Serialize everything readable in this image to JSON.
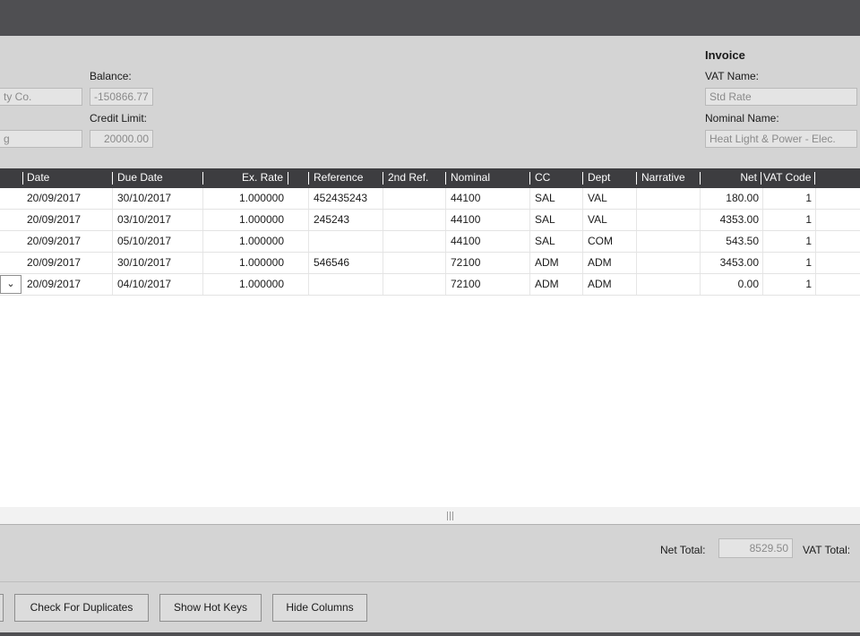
{
  "header": {
    "account_name_value": "ty Co.",
    "account_type_value": "g",
    "balance_label": "Balance:",
    "balance_value": "-150866.77",
    "credit_limit_label": "Credit Limit:",
    "credit_limit_value": "20000.00",
    "invoice_heading": "Invoice",
    "vat_name_label": "VAT Name:",
    "vat_name_value": "Std Rate",
    "nominal_name_label": "Nominal Name:",
    "nominal_name_value": "Heat Light & Power - Elec."
  },
  "grid": {
    "columns": [
      "Date",
      "Due Date",
      "Ex. Rate",
      "Reference",
      "2nd Ref.",
      "Nominal",
      "CC",
      "Dept",
      "Narrative",
      "Net",
      "VAT Code"
    ],
    "rows": [
      [
        "20/09/2017",
        "30/10/2017",
        "1.000000",
        "452435243",
        "",
        "44100",
        "SAL",
        "VAL",
        "",
        "180.00",
        "1"
      ],
      [
        "20/09/2017",
        "03/10/2017",
        "1.000000",
        "245243",
        "",
        "44100",
        "SAL",
        "VAL",
        "",
        "4353.00",
        "1"
      ],
      [
        "20/09/2017",
        "05/10/2017",
        "1.000000",
        "",
        "",
        "44100",
        "SAL",
        "COM",
        "",
        "543.50",
        "1"
      ],
      [
        "20/09/2017",
        "30/10/2017",
        "1.000000",
        "546546",
        "",
        "72100",
        "ADM",
        "ADM",
        "",
        "3453.00",
        "1"
      ],
      [
        "20/09/2017",
        "04/10/2017",
        "1.000000",
        "",
        "",
        "72100",
        "ADM",
        "ADM",
        "",
        "0.00",
        "1"
      ]
    ],
    "dropdown_icon": "chevron-down-icon"
  },
  "footer": {
    "net_total_label": "Net Total:",
    "net_total_value": "8529.50",
    "vat_total_label": "VAT Total:"
  },
  "buttons": {
    "check_duplicates": "Check For Duplicates",
    "show_hot_keys": "Show Hot Keys",
    "hide_columns": "Hide Columns"
  }
}
